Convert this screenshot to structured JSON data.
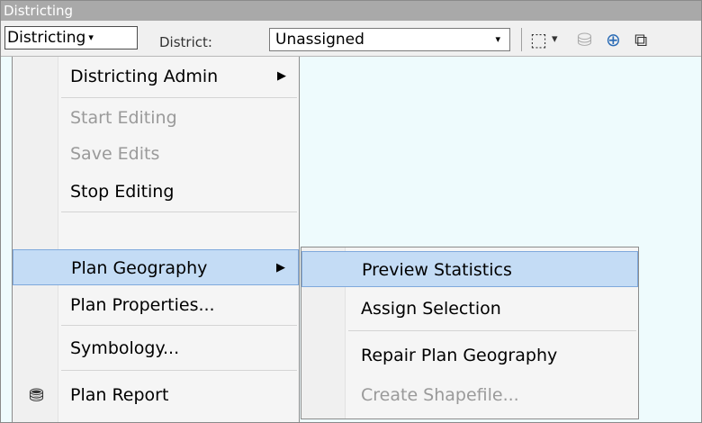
{
  "window": {
    "title": "Districting"
  },
  "toolbar": {
    "districting_button": "Districting",
    "districting_arrow": "▾",
    "district_label": "District:",
    "district_combo_value": "Unassigned",
    "combo_arrow": "▾",
    "tool1_glyph": "⬚",
    "tool2_glyph": "▾",
    "tool3_glyph": "⛁",
    "tool4_glyph": "⊕",
    "tool5_glyph": "⧉"
  },
  "menu": {
    "items": [
      {
        "label": "Districting Admin",
        "enabled": true,
        "has_submenu": true
      },
      {
        "label": "Start Editing",
        "enabled": false
      },
      {
        "label": "Save Edits",
        "enabled": false
      },
      {
        "label": "Stop Editing",
        "enabled": true
      },
      {
        "label": "Plan Geography",
        "enabled": true,
        "has_submenu": true,
        "highlighted": true
      },
      {
        "label": "Plan Properties...",
        "enabled": true
      },
      {
        "label": "Symbology...",
        "enabled": true
      },
      {
        "label": "Plan Report",
        "enabled": true,
        "icon": "report-icon"
      }
    ],
    "submenu_arrow": "▶",
    "report_icon_glyph": "⛃"
  },
  "submenu": {
    "items": [
      {
        "label": "Preview Statistics",
        "enabled": true,
        "highlighted": true
      },
      {
        "label": "Assign Selection",
        "enabled": true
      },
      {
        "label": "Repair Plan Geography",
        "enabled": true
      },
      {
        "label": "Create Shapefile...",
        "enabled": false
      }
    ]
  },
  "colors": {
    "title_bar": "#a9a9a9",
    "canvas": "#eefbfd",
    "highlight": "#c4dcf5"
  }
}
